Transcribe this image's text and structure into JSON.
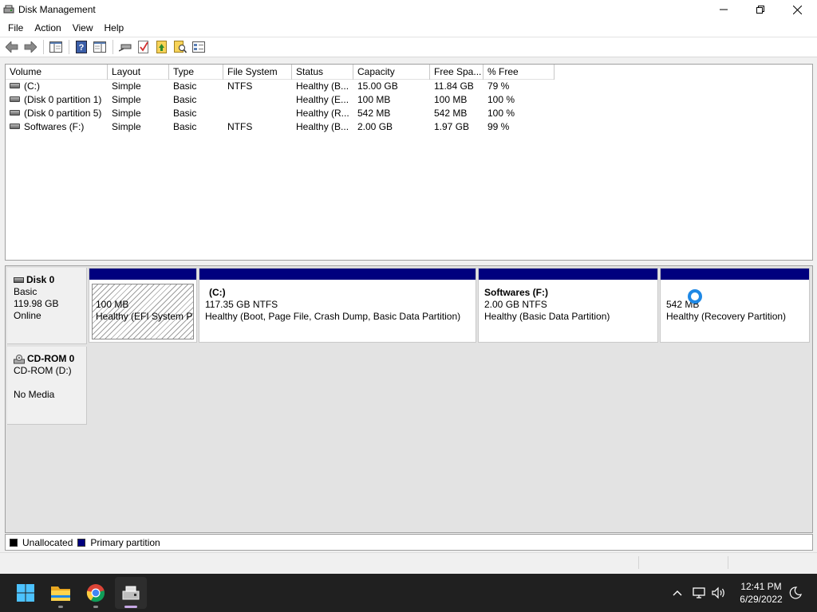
{
  "window": {
    "title": "Disk Management",
    "controls": {
      "minimize": "minimize",
      "maximize": "restore",
      "close": "close"
    }
  },
  "menu": [
    {
      "label": "File"
    },
    {
      "label": "Action"
    },
    {
      "label": "View"
    },
    {
      "label": "Help"
    }
  ],
  "toolbar": [
    {
      "icon": "back-arrow-icon"
    },
    {
      "icon": "forward-arrow-icon"
    },
    {
      "icon": "show-hide-console-tree-icon"
    },
    {
      "icon": "help-icon"
    },
    {
      "icon": "show-hide-action-pane-icon"
    },
    {
      "icon": "connect-drive-icon"
    },
    {
      "icon": "check-icon"
    },
    {
      "icon": "up-folder-icon"
    },
    {
      "icon": "search-folder-icon"
    },
    {
      "icon": "properties-icon"
    }
  ],
  "volume_table": {
    "columns": [
      "Volume",
      "Layout",
      "Type",
      "File System",
      "Status",
      "Capacity",
      "Free Spa...",
      "% Free"
    ],
    "rows": [
      {
        "volume": "(C:)",
        "layout": "Simple",
        "type": "Basic",
        "file_system": "NTFS",
        "status": "Healthy (B...",
        "capacity": "15.00 GB",
        "free": "11.84 GB",
        "pct_free": "79 %"
      },
      {
        "volume": "(Disk 0 partition 1)",
        "layout": "Simple",
        "type": "Basic",
        "file_system": "",
        "status": "Healthy (E...",
        "capacity": "100 MB",
        "free": "100 MB",
        "pct_free": "100 %"
      },
      {
        "volume": "(Disk 0 partition 5)",
        "layout": "Simple",
        "type": "Basic",
        "file_system": "",
        "status": "Healthy (R...",
        "capacity": "542 MB",
        "free": "542 MB",
        "pct_free": "100 %"
      },
      {
        "volume": "Softwares (F:)",
        "layout": "Simple",
        "type": "Basic",
        "file_system": "NTFS",
        "status": "Healthy (B...",
        "capacity": "2.00 GB",
        "free": "1.97 GB",
        "pct_free": "99 %"
      }
    ]
  },
  "disks": {
    "disk0": {
      "name": "Disk 0",
      "type": "Basic",
      "size": "119.98 GB",
      "state": "Online",
      "partitions": [
        {
          "name": "",
          "size": "100 MB",
          "status": "Healthy (EFI System Par"
        },
        {
          "name": "(C:)",
          "size": "117.35 GB NTFS",
          "status": "Healthy (Boot, Page File, Crash Dump, Basic Data Partition)"
        },
        {
          "name": "Softwares  (F:)",
          "size": "2.00 GB NTFS",
          "status": "Healthy (Basic Data Partition)"
        },
        {
          "name": "",
          "size": "542 MB",
          "status": "Healthy (Recovery Partition)"
        }
      ]
    },
    "cdrom0": {
      "name": "CD-ROM 0",
      "type": "CD-ROM (D:)",
      "state": "No Media"
    }
  },
  "legend": [
    {
      "label": "Unallocated",
      "color": "#000000"
    },
    {
      "label": "Primary partition",
      "color": "#00007e"
    }
  ],
  "taskbar": {
    "apps": [
      {
        "icon": "windows-start-icon"
      },
      {
        "icon": "file-explorer-icon"
      },
      {
        "icon": "chrome-icon"
      },
      {
        "icon": "disk-management-icon"
      }
    ],
    "time": "12:41 PM",
    "date": "6/29/2022"
  },
  "colors": {
    "primary_partition": "#00007e",
    "taskbar": "#202020",
    "cursor_ring": "#1e88e5"
  }
}
